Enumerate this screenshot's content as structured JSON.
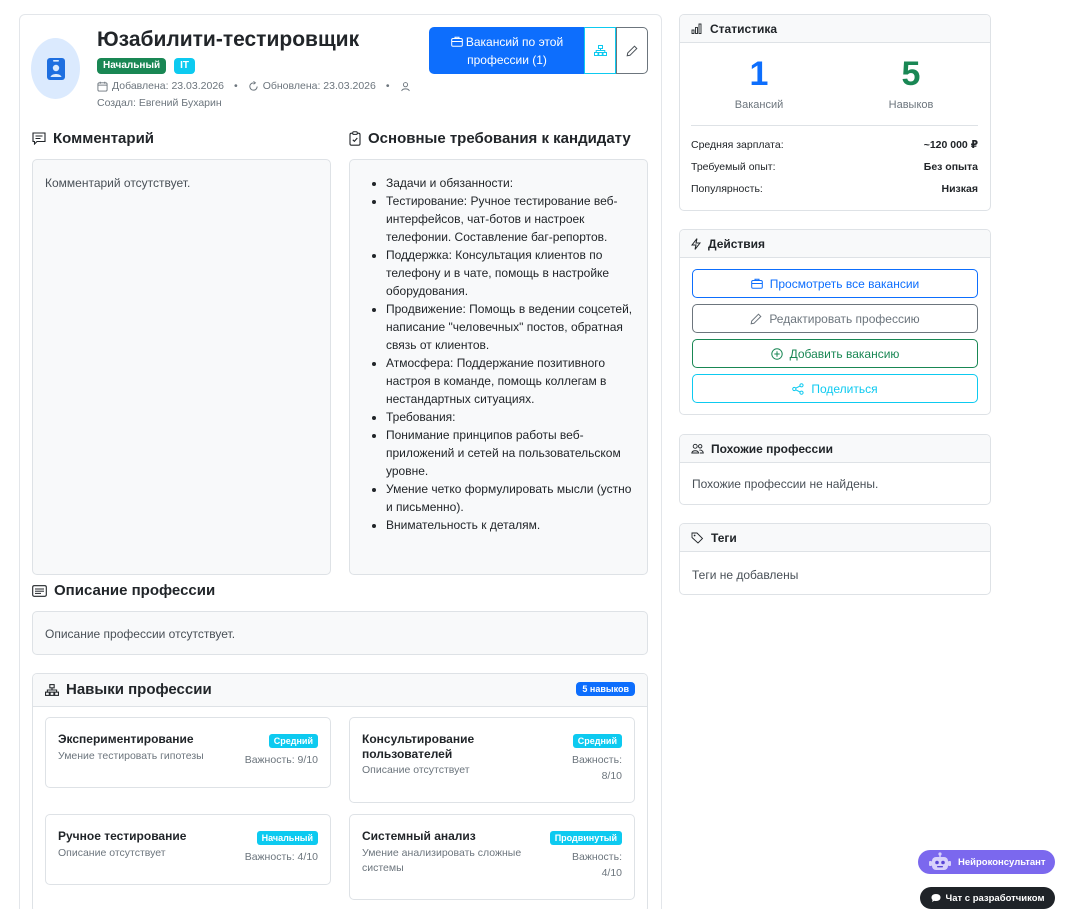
{
  "profession": {
    "title": "Юзабилити-тестировщик",
    "badge_level": "Начальный",
    "badge_category": "IT",
    "added": "Добавлена: 23.03.2026",
    "updated": "Обновлена: 23.03.2026",
    "created_by": "Создал: Евгений Бухарин",
    "btn_vacancies": "Вакансий по этой профессии (1)"
  },
  "comment": {
    "title": "Комментарий",
    "text": "Комментарий отсутствует."
  },
  "requirements": {
    "title": "Основные требования к кандидату",
    "items": [
      "Задачи и обязанности:",
      "Тестирование: Ручное тестирование веб-интерфейсов, чат-ботов и настроек телефонии. Составление баг-репортов.",
      "Поддержка: Консультация клиентов по телефону и в чате, помощь в настройке оборудования.",
      "Продвижение: Помощь в ведении соцсетей, написание \"человечных\" постов, обратная связь от клиентов.",
      "Атмосфера: Поддержание позитивного настроя в команде, помощь коллегам в нестандартных ситуациях.",
      "Требования:",
      "Понимание принципов работы веб-приложений и сетей на пользовательском уровне.",
      "Умение четко формулировать мысли (устно и письменно).",
      "Внимательность к деталям."
    ]
  },
  "description": {
    "title": "Описание профессии",
    "text": "Описание профессии отсутствует."
  },
  "skills": {
    "title": "Навыки профессии",
    "count": "5 навыков",
    "items": [
      {
        "name": "Экспериментирование",
        "desc": "Умение тестировать гипотезы",
        "level": "Средний",
        "importance": "Важность: 9/10"
      },
      {
        "name": "Консультирование пользователей",
        "desc": "Описание отсутствует",
        "level": "Средний",
        "importance": "Важность: 8/10"
      },
      {
        "name": "Ручное тестирование",
        "desc": "Описание отсутствует",
        "level": "Начальный",
        "importance": "Важность: 4/10"
      },
      {
        "name": "Системный анализ",
        "desc": "Умение анализировать сложные системы",
        "level": "Продвинутый",
        "importance": "Важность: 4/10"
      }
    ]
  },
  "stats": {
    "title": "Статистика",
    "vacancies_value": "1",
    "vacancies_label": "Вакансий",
    "skills_value": "5",
    "skills_label": "Навыков",
    "salary_label": "Средняя зарплата:",
    "salary_value": "~120 000 ₽",
    "experience_label": "Требуемый опыт:",
    "experience_value": "Без опыта",
    "popularity_label": "Популярность:",
    "popularity_value": "Низкая"
  },
  "actions": {
    "title": "Действия",
    "view_all": "Просмотреть все вакансии",
    "edit": "Редактировать профессию",
    "add_vacancy": "Добавить вакансию",
    "share": "Поделиться"
  },
  "similar": {
    "title": "Похожие профессии",
    "text": "Похожие профессии не найдены."
  },
  "tags": {
    "title": "Теги",
    "text": "Теги не добавлены"
  },
  "floating": {
    "neuro": "Нейроконсультант",
    "chat": "Чат с разработчиком"
  },
  "colors": {
    "primary": "#0d6efd",
    "success": "#198754",
    "info": "#0dcaf0",
    "secondary": "#6c757d",
    "neuro": "#7b68ee"
  }
}
